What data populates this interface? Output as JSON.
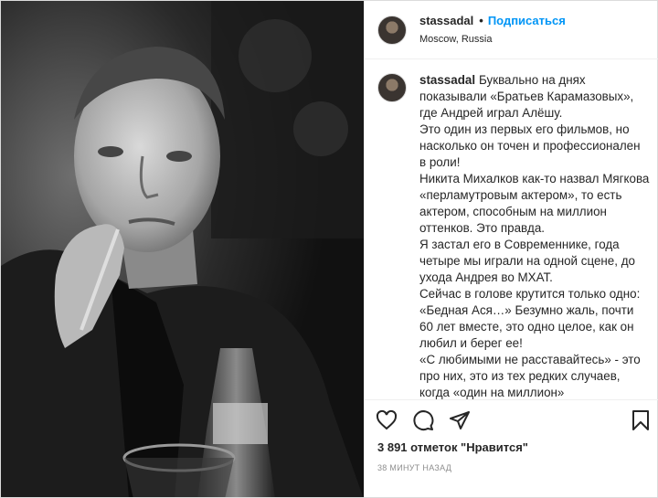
{
  "post": {
    "username": "stassadal",
    "follow_label": "Подписаться",
    "separator": "•",
    "location": "Moscow, Russia",
    "caption": "Буквально на днях показывали «Братьев Карамазовых», где Андрей играл Алёшу.\nЭто один из первых его фильмов, но насколько он точен и профессионален в роли!\nНикита Михалков как-то назвал Мягкова «перламутровым актером», то есть актером, способным на миллион оттенков. Это правда.\nЯ застал его в Современнике, года четыре мы играли на одной сцене, до ухода Андрея во МХАТ.\nСейчас в голове крутится только одно: «Бедная Ася…» Безумно жаль, почти 60 лет вместе, это одно целое, как он любил и берег ее!\n«С любимыми не расставайтесь» - это про них, это из тех редких случаев, когда «один на миллион»",
    "likes": "3 891 отметок \"Нравится\"",
    "time": "38 МИНУТ НАЗАД"
  },
  "icons": {
    "like": "heart-icon",
    "comment": "comment-bubble-icon",
    "share": "paper-plane-icon",
    "save": "bookmark-icon"
  },
  "colors": {
    "accent": "#0095f6",
    "text": "#262626",
    "muted": "#8e8e8e",
    "border": "#dbdbdb"
  }
}
